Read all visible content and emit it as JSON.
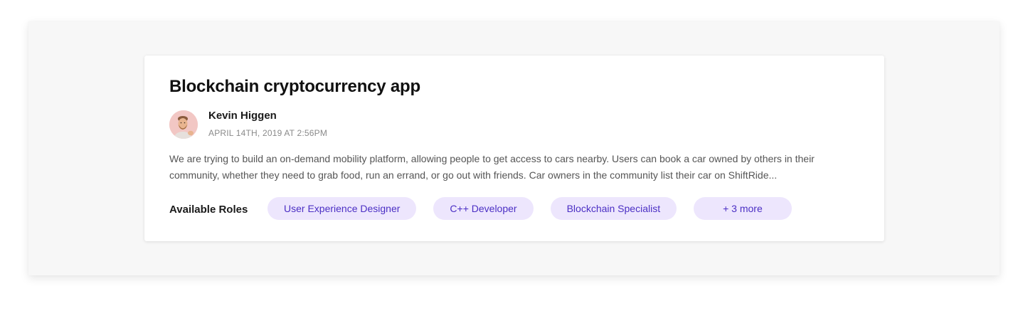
{
  "project": {
    "title": "Blockchain cryptocurrency app",
    "author": {
      "name": "Kevin Higgen",
      "posted_at": "APRIL 14TH, 2019 AT 2:56PM"
    },
    "description": "We are trying to build an on-demand mobility platform, allowing people to get access to cars nearby. Users can book a car owned by others in their community, whether they need to grab food, run an errand, or go out with friends. Car owners in the community list their car on ShiftRide...",
    "roles_label": "Available Roles",
    "roles": [
      "User Experience Designer",
      "C++ Developer",
      "Blockchain Specialist"
    ],
    "more_roles_label": "+ 3 more"
  },
  "colors": {
    "tag_background": "#ede6fd",
    "tag_text": "#4b2fc4",
    "avatar_background": "#f2c7c4"
  }
}
